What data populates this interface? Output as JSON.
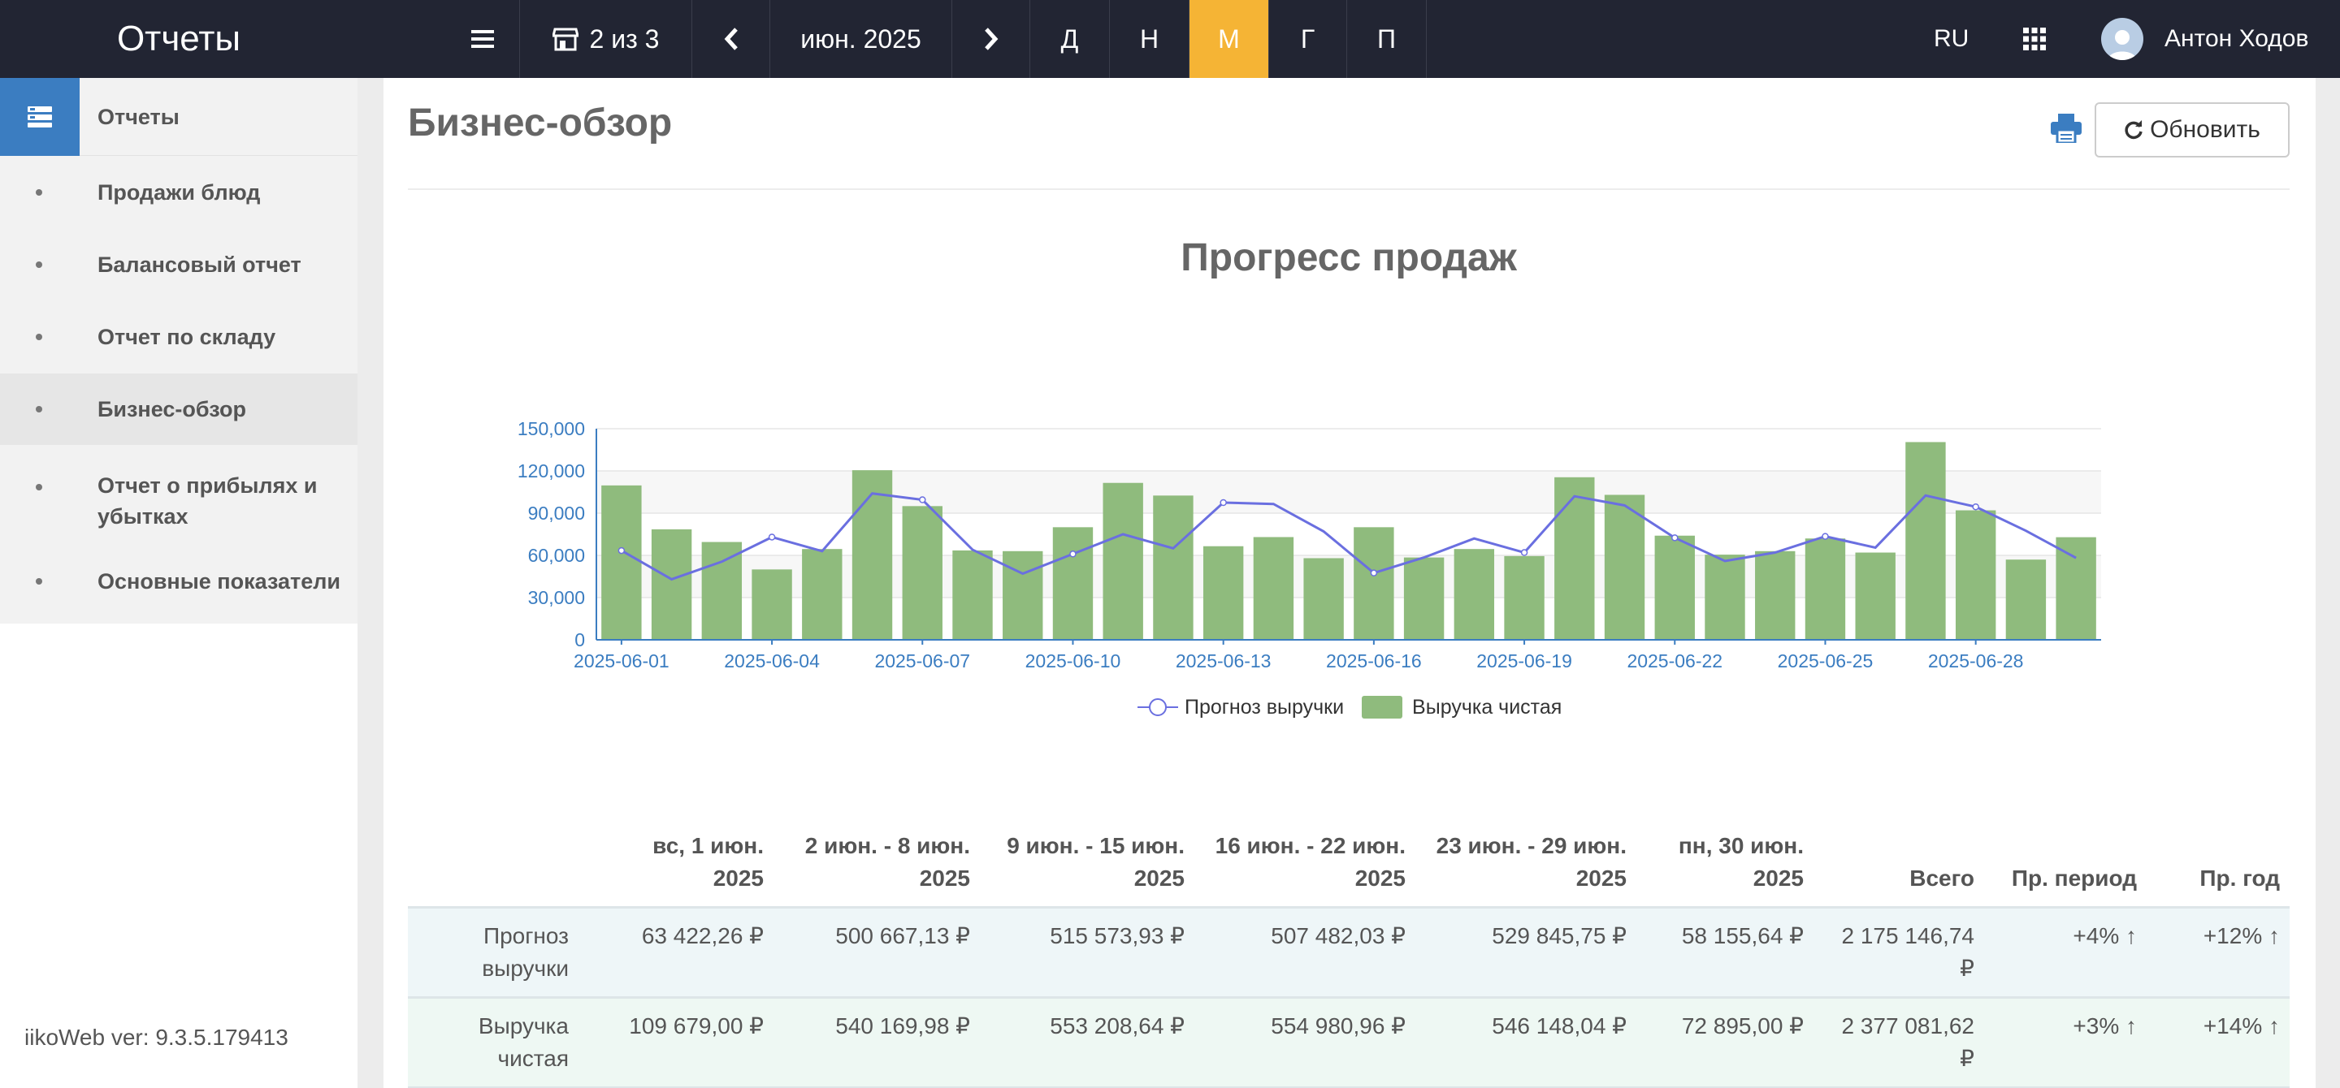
{
  "topbar": {
    "title": "Отчеты",
    "menu_icon": "hamburger-icon",
    "store_label": "2 из 3",
    "period_label": "июн. 2025",
    "period_buttons": [
      "Д",
      "Н",
      "М",
      "Г",
      "П"
    ],
    "active_period": "М",
    "language": "RU",
    "user_name": "Антон Ходов",
    "accent_color": "#f5b435",
    "bar_color": "#222533"
  },
  "sidebar": {
    "header_label": "Отчеты",
    "items": [
      {
        "label": "Продажи блюд"
      },
      {
        "label": "Балансовый отчет"
      },
      {
        "label": "Отчет по складу"
      },
      {
        "label": "Бизнес-обзор",
        "active": true
      },
      {
        "label": "Отчет о прибылях и убытках"
      },
      {
        "label": "Основные показатели"
      }
    ],
    "version": "iikoWeb ver: 9.3.5.179413"
  },
  "main": {
    "page_title": "Бизнес-обзор",
    "refresh_label": "Обновить"
  },
  "chart_data": {
    "type": "bar",
    "title": "Прогресс продаж",
    "x_tick_labels": [
      "2025-06-01",
      "2025-06-04",
      "2025-06-07",
      "2025-06-10",
      "2025-06-13",
      "2025-06-16",
      "2025-06-19",
      "2025-06-22",
      "2025-06-25",
      "2025-06-28"
    ],
    "y_tick_labels": [
      "0",
      "30,000",
      "60,000",
      "90,000",
      "120,000",
      "150,000"
    ],
    "ylim": [
      0,
      150000
    ],
    "categories": [
      "2025-06-01",
      "2025-06-02",
      "2025-06-03",
      "2025-06-04",
      "2025-06-05",
      "2025-06-06",
      "2025-06-07",
      "2025-06-08",
      "2025-06-09",
      "2025-06-10",
      "2025-06-11",
      "2025-06-12",
      "2025-06-13",
      "2025-06-14",
      "2025-06-15",
      "2025-06-16",
      "2025-06-17",
      "2025-06-18",
      "2025-06-19",
      "2025-06-20",
      "2025-06-21",
      "2025-06-22",
      "2025-06-23",
      "2025-06-24",
      "2025-06-25",
      "2025-06-26",
      "2025-06-27",
      "2025-06-28",
      "2025-06-29",
      "2025-06-30"
    ],
    "series": [
      {
        "name": "Выручка чистая",
        "type": "bar",
        "color": "#8fbb7d",
        "values": [
          109700,
          78500,
          69500,
          50000,
          64500,
          120500,
          95000,
          63500,
          63000,
          80000,
          111500,
          102500,
          66500,
          73000,
          58000,
          80000,
          58500,
          64500,
          59500,
          115500,
          103000,
          74000,
          60500,
          63000,
          72000,
          62000,
          140500,
          92000,
          57000,
          72900
        ]
      },
      {
        "name": "Прогноз выручки",
        "type": "line",
        "color": "#6a6fe0",
        "values": [
          63400,
          43000,
          55500,
          73000,
          63000,
          104000,
          99500,
          64000,
          47000,
          61000,
          75000,
          65000,
          97500,
          96500,
          77000,
          47500,
          58500,
          72000,
          62000,
          102000,
          95500,
          72500,
          56000,
          62000,
          73500,
          65500,
          102500,
          94500,
          77500,
          58200
        ]
      }
    ],
    "legend": [
      "Прогноз выручки",
      "Выручка чистая"
    ],
    "legend_position": "bottom"
  },
  "table": {
    "headers": [
      {
        "l1": "",
        "l2": ""
      },
      {
        "l1": "вс, 1 июн.",
        "l2": "2025"
      },
      {
        "l1": "2 июн. - 8 июн.",
        "l2": "2025"
      },
      {
        "l1": "9 июн. - 15 июн.",
        "l2": "2025"
      },
      {
        "l1": "16 июн. - 22 июн.",
        "l2": "2025"
      },
      {
        "l1": "23 июн. - 29 июн.",
        "l2": "2025"
      },
      {
        "l1": "пн, 30 июн.",
        "l2": "2025"
      },
      {
        "l1": "Всего",
        "l2": ""
      },
      {
        "l1": "Пр. период",
        "l2": ""
      },
      {
        "l1": "Пр. год",
        "l2": ""
      }
    ],
    "rows": [
      {
        "label1": "Прогноз",
        "label2": "выручки",
        "cells": [
          "63 422,26 ₽",
          "500 667,13 ₽",
          "515 573,93 ₽",
          "507 482,03 ₽",
          "529 845,75 ₽",
          "58 155,64 ₽",
          "2 175 146,74 ₽",
          "+4% ↑",
          "+12% ↑"
        ]
      },
      {
        "label1": "Выручка",
        "label2": "чистая",
        "cells": [
          "109 679,00 ₽",
          "540 169,98 ₽",
          "553 208,64 ₽",
          "554 980,96 ₽",
          "546 148,04 ₽",
          "72 895,00 ₽",
          "2 377 081,62 ₽",
          "+3% ↑",
          "+14% ↑"
        ]
      }
    ]
  }
}
